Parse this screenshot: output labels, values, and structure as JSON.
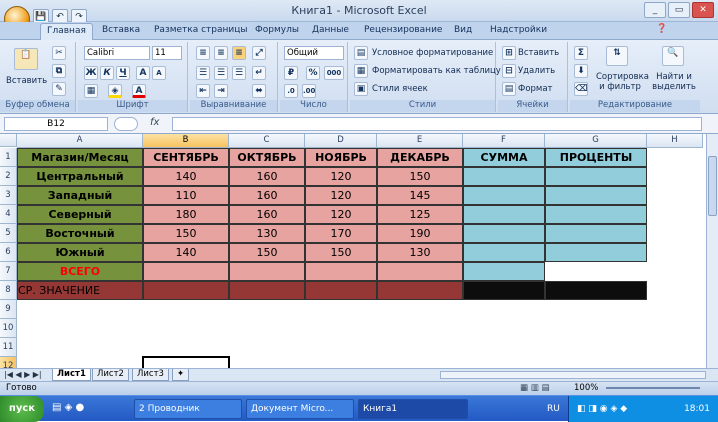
{
  "window": {
    "title": "Книга1 - Microsoft Excel"
  },
  "qat": {
    "save": "💾",
    "undo": "↶",
    "redo": "↷"
  },
  "tabs": [
    "Главная",
    "Вставка",
    "Разметка страницы",
    "Формулы",
    "Данные",
    "Рецензирование",
    "Вид",
    "Надстройки"
  ],
  "ribbon": {
    "clipboard": {
      "paste": "Вставить",
      "label": "Буфер обмена"
    },
    "font": {
      "name": "Calibri",
      "size": "11",
      "bold": "Ж",
      "italic": "К",
      "underline": "Ч",
      "label": "Шрифт"
    },
    "alignment": {
      "label": "Выравнивание"
    },
    "number": {
      "format": "Общий",
      "percent": "%",
      "thousands": "000",
      "label": "Число"
    },
    "styles": {
      "conditional": "Условное форматирование",
      "as_table": "Форматировать как таблицу",
      "cell_styles": "Стили ячеек",
      "label": "Стили"
    },
    "cells": {
      "insert": "Вставить",
      "delete": "Удалить",
      "format": "Формат",
      "label": "Ячейки"
    },
    "editing": {
      "sum": "Σ",
      "sort": "Сортировка и фильтр",
      "find": "Найти и выделить",
      "label": "Редактирование"
    }
  },
  "formula_bar": {
    "name_box": "B12",
    "fx": "fx",
    "value": ""
  },
  "columns": [
    "A",
    "B",
    "C",
    "D",
    "E",
    "F",
    "G",
    "H"
  ],
  "rows": [
    "1",
    "2",
    "3",
    "4",
    "5",
    "6",
    "7",
    "8",
    "9",
    "10",
    "11",
    "12"
  ],
  "table": {
    "headers": [
      "Магазин/Месяц",
      "СЕНТЯБРЬ",
      "ОКТЯБРЬ",
      "НОЯБРЬ",
      "ДЕКАБРЬ",
      "СУММА",
      "ПРОЦЕНТЫ"
    ],
    "stores": [
      {
        "name": "Центральный",
        "values": [
          "140",
          "160",
          "120",
          "150"
        ]
      },
      {
        "name": "Западный",
        "values": [
          "110",
          "160",
          "120",
          "145"
        ]
      },
      {
        "name": "Северный",
        "values": [
          "180",
          "160",
          "120",
          "125"
        ]
      },
      {
        "name": "Восточный",
        "values": [
          "150",
          "130",
          "170",
          "190"
        ]
      },
      {
        "name": "Южный",
        "values": [
          "140",
          "150",
          "150",
          "130"
        ]
      }
    ],
    "total_label": "ВСЕГО",
    "avg_label": "СР. ЗНАЧЕНИЕ"
  },
  "sheets": [
    "Лист1",
    "Лист2",
    "Лист3"
  ],
  "status": {
    "ready": "Готово",
    "zoom": "100%"
  },
  "taskbar": {
    "start": "пуск",
    "items": [
      "2 Проводник",
      "Документ Micro...",
      "Книга1"
    ],
    "lang": "RU",
    "time": "18:01"
  },
  "colors": {
    "green": "#76923c",
    "pink": "#e6a3a0",
    "blue": "#92cddc",
    "darkred": "#953734",
    "black": "#0d0d0d",
    "red_text": "#ff0000"
  }
}
